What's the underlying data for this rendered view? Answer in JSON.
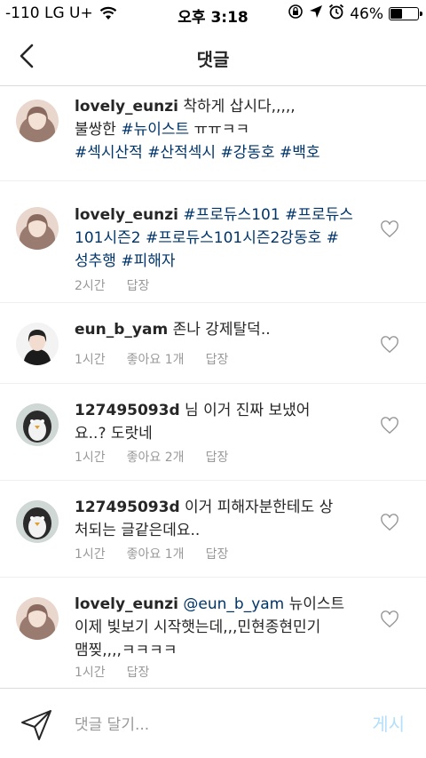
{
  "status": {
    "carrier": "-110 LG U+",
    "time": "오후 3:18",
    "battery": "46%",
    "battery_level": 0.46
  },
  "header": {
    "title": "댓글"
  },
  "comments": [
    {
      "user": "lovely_eunzi",
      "parts": [
        " 착하게 삽시다,,,,,",
        "불쌍한 ",
        "#뉴이스트",
        " ㅠㅠㅋㅋ",
        "#섹시산적",
        " ",
        "#산적섹시",
        " ",
        "#강동호",
        " ",
        "#백호"
      ]
    },
    {
      "user": "lovely_eunzi",
      "parts": [
        "#프로듀스101",
        " ",
        "#프로듀스",
        "101시즌2",
        " ",
        "#프로듀스101시즌2강동호",
        " ",
        "#",
        "성추행",
        " ",
        "#피해자"
      ],
      "time": "2시간",
      "reply": "답장"
    },
    {
      "user": "eun_b_yam",
      "text": " 존나 강제탈덕..",
      "time": "1시간",
      "likes": "좋아요 1개",
      "reply": "답장"
    },
    {
      "user": "127495093d",
      "text1": " 님 이거 진짜 보냈어",
      "text2": "요..? 도랏네",
      "time": "1시간",
      "likes": "좋아요 2개",
      "reply": "답장"
    },
    {
      "user": "127495093d",
      "text1": " 이거 피해자분한테도 상",
      "text2": "처되는 글같은데요..",
      "time": "1시간",
      "likes": "좋아요 1개",
      "reply": "답장"
    },
    {
      "user": "lovely_eunzi",
      "mention": "@eun_b_yam",
      "text1": " 뉴이스트",
      "text2": "이제 빛보기 시작햇는데,,,민현종현민기",
      "text3": "맴찢,,,,ㅋㅋㅋㅋ",
      "time": "1시간",
      "reply": "답장"
    }
  ],
  "input": {
    "placeholder": "댓글 달기...",
    "post": "게시"
  }
}
